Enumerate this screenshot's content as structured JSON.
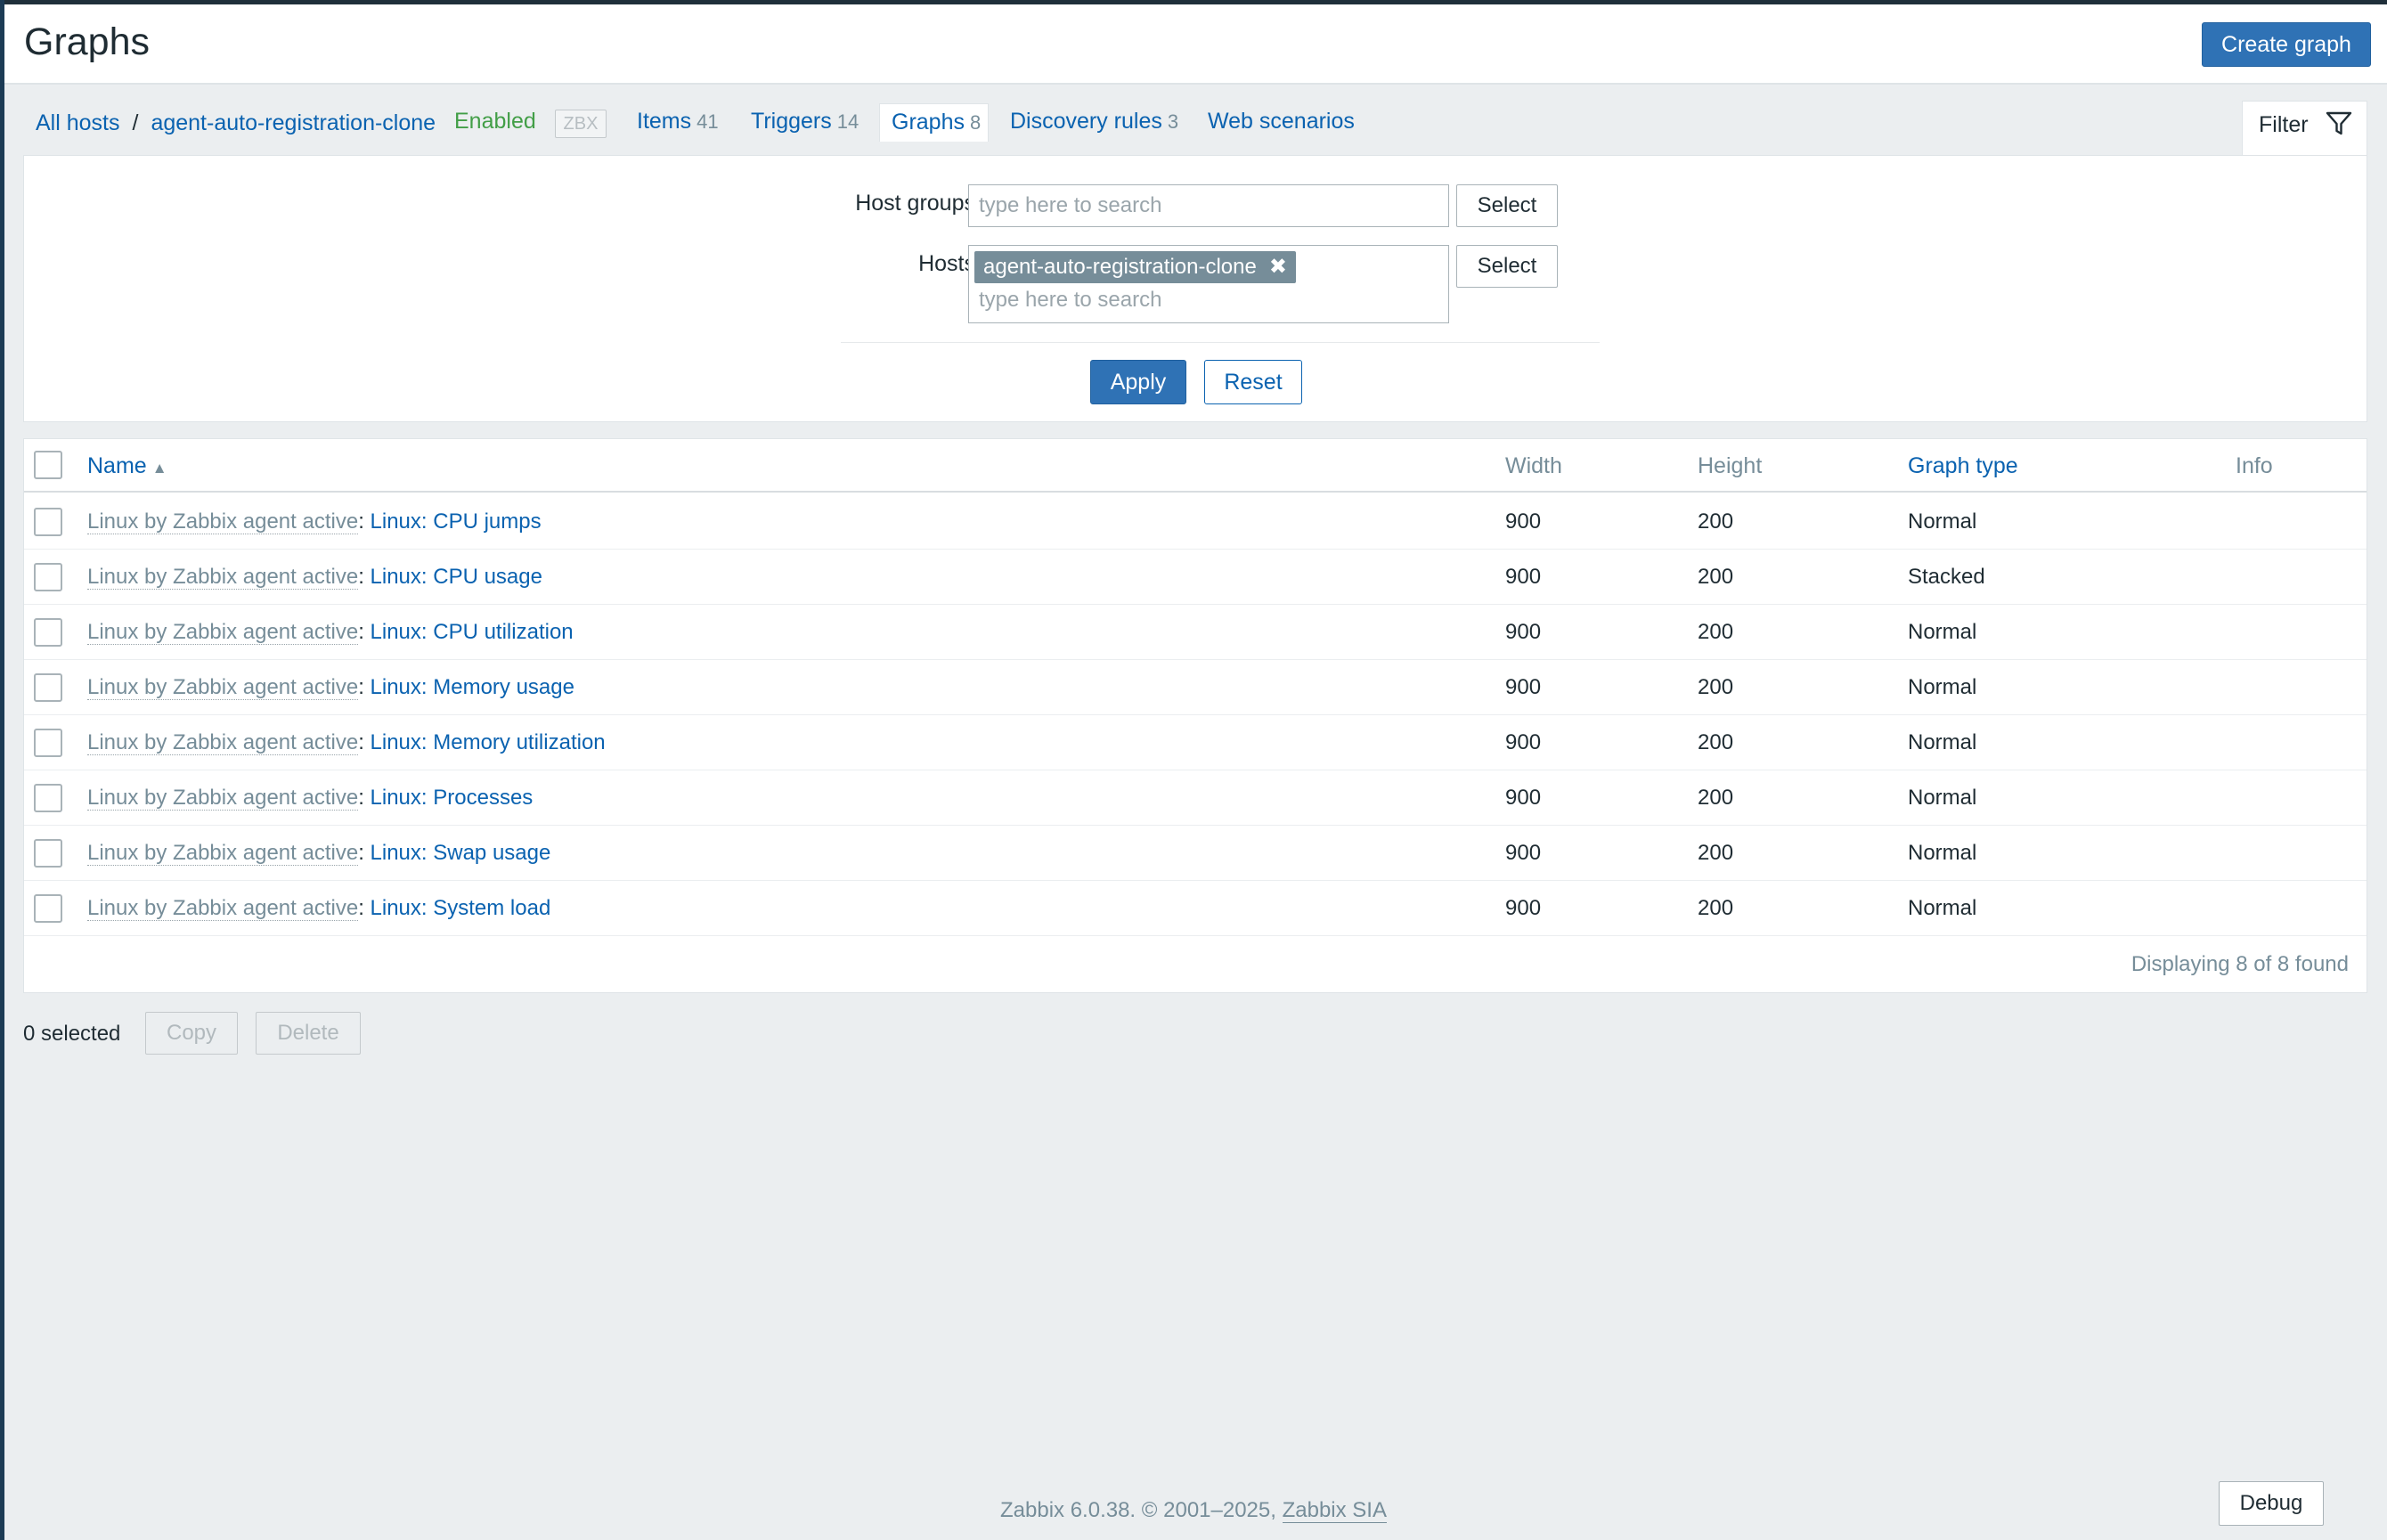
{
  "header": {
    "title": "Graphs",
    "create_button": "Create graph"
  },
  "nav": {
    "all_hosts": "All hosts",
    "separator": "/",
    "host": "agent-auto-registration-clone",
    "status": "Enabled",
    "zbx_badge": "ZBX",
    "tabs": [
      {
        "label": "Items",
        "count": "41"
      },
      {
        "label": "Triggers",
        "count": "14"
      },
      {
        "label": "Graphs",
        "count": "8"
      },
      {
        "label": "Discovery rules",
        "count": "3"
      },
      {
        "label": "Web scenarios",
        "count": ""
      }
    ],
    "filter_label": "Filter"
  },
  "filter": {
    "host_groups_label": "Host groups",
    "host_groups_placeholder": "type here to search",
    "hosts_label": "Hosts",
    "hosts_chip": "agent-auto-registration-clone",
    "chip_remove": "✖",
    "hosts_placeholder": "type here to search",
    "select_label": "Select",
    "apply_label": "Apply",
    "reset_label": "Reset"
  },
  "table": {
    "columns": {
      "name": "Name",
      "width": "Width",
      "height": "Height",
      "graph_type": "Graph type",
      "info": "Info"
    },
    "sort_indicator": "▲",
    "rows": [
      {
        "template": "Linux by Zabbix agent active",
        "name": "Linux: CPU jumps",
        "width": "900",
        "height": "200",
        "type": "Normal"
      },
      {
        "template": "Linux by Zabbix agent active",
        "name": "Linux: CPU usage",
        "width": "900",
        "height": "200",
        "type": "Stacked"
      },
      {
        "template": "Linux by Zabbix agent active",
        "name": "Linux: CPU utilization",
        "width": "900",
        "height": "200",
        "type": "Normal"
      },
      {
        "template": "Linux by Zabbix agent active",
        "name": "Linux: Memory usage",
        "width": "900",
        "height": "200",
        "type": "Normal"
      },
      {
        "template": "Linux by Zabbix agent active",
        "name": "Linux: Memory utilization",
        "width": "900",
        "height": "200",
        "type": "Normal"
      },
      {
        "template": "Linux by Zabbix agent active",
        "name": "Linux: Processes",
        "width": "900",
        "height": "200",
        "type": "Normal"
      },
      {
        "template": "Linux by Zabbix agent active",
        "name": "Linux: Swap usage",
        "width": "900",
        "height": "200",
        "type": "Normal"
      },
      {
        "template": "Linux by Zabbix agent active",
        "name": "Linux: System load",
        "width": "900",
        "height": "200",
        "type": "Normal"
      }
    ],
    "displaying": "Displaying 8 of 8 found"
  },
  "actions": {
    "selected": "0 selected",
    "copy": "Copy",
    "delete": "Delete"
  },
  "footer": {
    "text": "Zabbix 6.0.38. © 2001–2025, ",
    "company": "Zabbix SIA",
    "debug": "Debug"
  },
  "colors": {
    "primary_blue": "#2f72b5",
    "link_blue": "#0a62b0",
    "enabled_green": "#429e47",
    "muted_gray": "#768d99",
    "page_bg": "#ebeef0"
  }
}
